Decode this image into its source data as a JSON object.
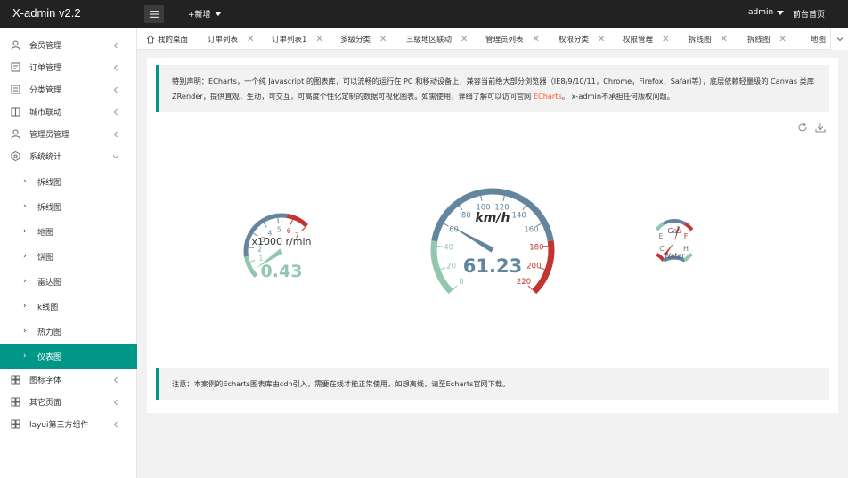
{
  "header": {
    "logo": "X-admin v2.2",
    "add_new": "+新增",
    "user": "admin",
    "frontpage": "前台首页"
  },
  "sidebar": {
    "items": [
      {
        "label": "会员管理",
        "icon": "user-icon"
      },
      {
        "label": "订单管理",
        "icon": "order-icon"
      },
      {
        "label": "分类管理",
        "icon": "category-icon"
      },
      {
        "label": "城市联动",
        "icon": "city-icon"
      },
      {
        "label": "管理员管理",
        "icon": "admin-icon"
      },
      {
        "label": "系统统计",
        "icon": "stats-icon"
      }
    ],
    "sub_items": [
      {
        "label": "拆线图"
      },
      {
        "label": "拆线图"
      },
      {
        "label": "地图"
      },
      {
        "label": "饼图"
      },
      {
        "label": "雷达图"
      },
      {
        "label": "k线图"
      },
      {
        "label": "热力图"
      },
      {
        "label": "仪表图"
      }
    ],
    "bottom_items": [
      {
        "label": "图标字体",
        "icon": "font-icon"
      },
      {
        "label": "其它页面",
        "icon": "pages-icon"
      },
      {
        "label": "layui第三方组件",
        "icon": "component-icon"
      }
    ],
    "active_color": "#009688"
  },
  "tabs": [
    {
      "label": "我的桌面"
    },
    {
      "label": "订单列表"
    },
    {
      "label": "订单列表1"
    },
    {
      "label": "多级分类"
    },
    {
      "label": "三级地区联动"
    },
    {
      "label": "管理员列表"
    },
    {
      "label": "权限分类"
    },
    {
      "label": "权限管理"
    },
    {
      "label": "拆线图"
    },
    {
      "label": "拆线图"
    },
    {
      "label": "地图"
    }
  ],
  "notice": {
    "text1": "特别声明：ECharts，一个纯 Javascript 的图表库，可以流畅的运行在 PC 和移动设备上，兼容当前绝大部分浏览器（IE8/9/10/11，Chrome，Firefox，Safari等），底层依赖轻量级的 Canvas 类库 ZRender，提供直观，生动，可交互，可高度个性化定制的数据可视化图表。如需使用，详细了解可以访问官网 ",
    "link": "ECharts",
    "text2": "。 x-admin不承担任何版权问题。"
  },
  "footer_notice": "注意：本案例的Echarts图表库由cdn引入，需要在线才能正常使用，如想离线，请至Echarts官网下载。",
  "chart_data": {
    "type": "gauge",
    "gauges": [
      {
        "name": "rpm",
        "unit": "x1000 r/min",
        "value": 0.43,
        "min": 0,
        "max": 7,
        "ticks": [
          "1",
          "2",
          "3",
          "4",
          "5",
          "6",
          "7"
        ]
      },
      {
        "name": "speed",
        "unit": "km/h",
        "value": 61.23,
        "min": 0,
        "max": 220,
        "ticks": [
          "0",
          "20",
          "40",
          "60",
          "80",
          "100",
          "120",
          "140",
          "160",
          "180",
          "200",
          "220"
        ]
      },
      {
        "name": "fuel-water",
        "labels": [
          "Gas",
          "E",
          "F",
          "Water",
          "C",
          "H"
        ]
      }
    ],
    "colors": {
      "low": "#91c7ae",
      "mid": "#63869e",
      "high": "#c23531"
    }
  }
}
